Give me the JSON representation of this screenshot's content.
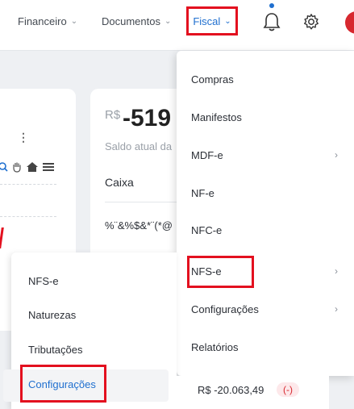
{
  "colors": {
    "accent": "#1f6fcf",
    "highlight_red": "#e3101f",
    "negative": "#d7282f"
  },
  "nav": {
    "financeiro": "Financeiro",
    "documentos": "Documentos",
    "fiscal": "Fiscal"
  },
  "balance_card": {
    "currency": "R$",
    "value": "-519",
    "label": "Saldo atual da",
    "column_header": "Caixa",
    "garbled_row": "%¨&%$&*¨(*@"
  },
  "fiscal_menu": {
    "items": [
      {
        "label": "Compras",
        "has_submenu": false
      },
      {
        "label": "Manifestos",
        "has_submenu": false
      },
      {
        "label": "MDF-e",
        "has_submenu": true
      },
      {
        "label": "NF-e",
        "has_submenu": false
      },
      {
        "label": "NFC-e",
        "has_submenu": false
      },
      {
        "label": "NFS-e",
        "has_submenu": true
      },
      {
        "label": "Configurações",
        "has_submenu": true
      },
      {
        "label": "Relatórios",
        "has_submenu": false
      }
    ]
  },
  "nfse_submenu": {
    "items": [
      {
        "label": "NFS-e"
      },
      {
        "label": "Naturezas"
      },
      {
        "label": "Tributações"
      },
      {
        "label": "Configurações",
        "active": true
      }
    ]
  },
  "transaction": {
    "amount": "R$ -20.063,49",
    "badge": "(-)"
  }
}
